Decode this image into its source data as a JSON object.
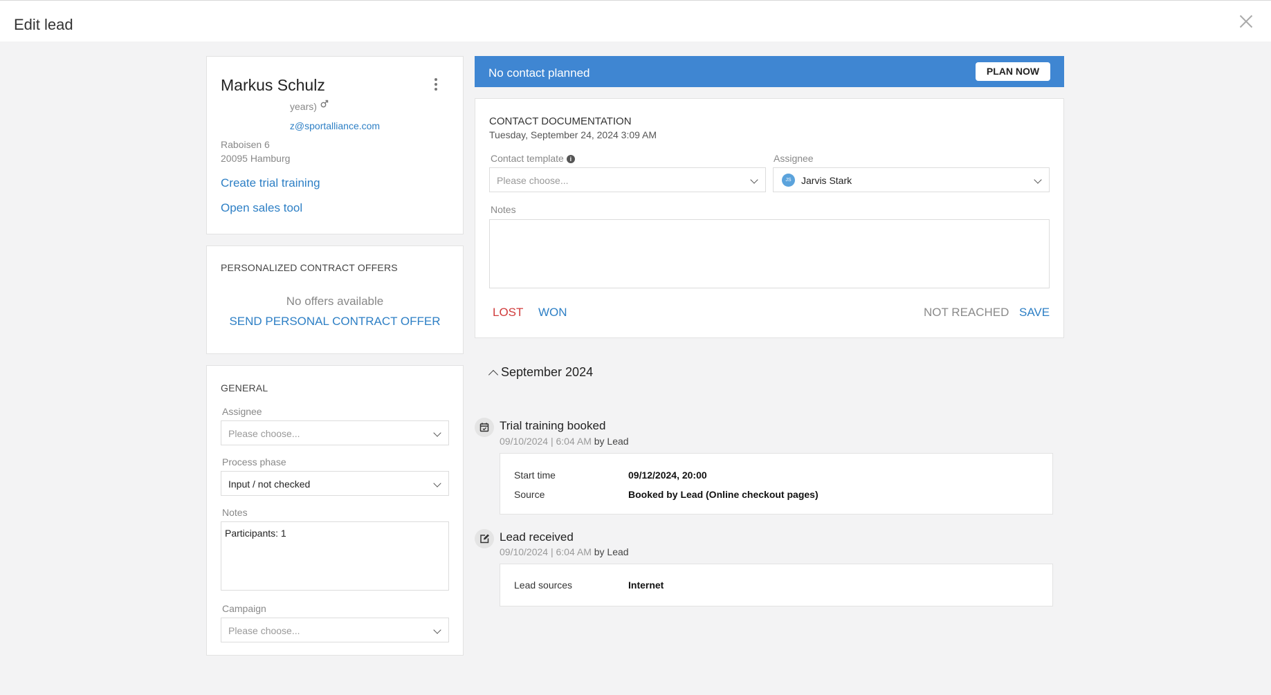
{
  "header": {
    "title": "Edit lead"
  },
  "person": {
    "name": "Markus Schulz",
    "age_text": "years)",
    "email": "z@sportalliance.com",
    "street": "Raboisen 6",
    "city": "20095 Hamburg",
    "create_trial": "Create trial training",
    "open_sales": "Open sales tool"
  },
  "offers": {
    "title": "PERSONALIZED CONTRACT OFFERS",
    "empty": "No offers available",
    "send": "SEND PERSONAL CONTRACT OFFER"
  },
  "general": {
    "title": "GENERAL",
    "assignee_label": "Assignee",
    "assignee_placeholder": "Please choose...",
    "phase_label": "Process phase",
    "phase_value": "Input / not checked",
    "notes_label": "Notes",
    "notes_value": "Participants: 1",
    "campaign_label": "Campaign",
    "campaign_placeholder": "Please choose..."
  },
  "banner": {
    "text": "No contact planned",
    "button": "PLAN NOW"
  },
  "doc": {
    "title": "CONTACT DOCUMENTATION",
    "date": "Tuesday, September 24, 2024 3:09 AM",
    "template_label": "Contact template",
    "template_placeholder": "Please choose...",
    "assignee_label": "Assignee",
    "assignee_initials": "JS",
    "assignee_value": "Jarvis Stark",
    "notes_label": "Notes",
    "lost": "LOST",
    "won": "WON",
    "not_reached": "NOT REACHED",
    "save": "SAVE"
  },
  "timeline": {
    "month": "September 2024",
    "events": [
      {
        "title": "Trial training booked",
        "time": "09/10/2024 | 6:04 AM",
        "by": "by Lead",
        "rows": [
          {
            "key": "Start time",
            "value": "09/12/2024, 20:00"
          },
          {
            "key": "Source",
            "value": "Booked by Lead (Online checkout pages)"
          }
        ]
      },
      {
        "title": "Lead received",
        "time": "09/10/2024 | 6:04 AM",
        "by": "by Lead",
        "rows": [
          {
            "key": "Lead sources",
            "value": "Internet"
          }
        ]
      }
    ]
  },
  "colors": {
    "accent": "#2d7fc5",
    "banner": "#3f86d2",
    "danger": "#d03a3a"
  }
}
